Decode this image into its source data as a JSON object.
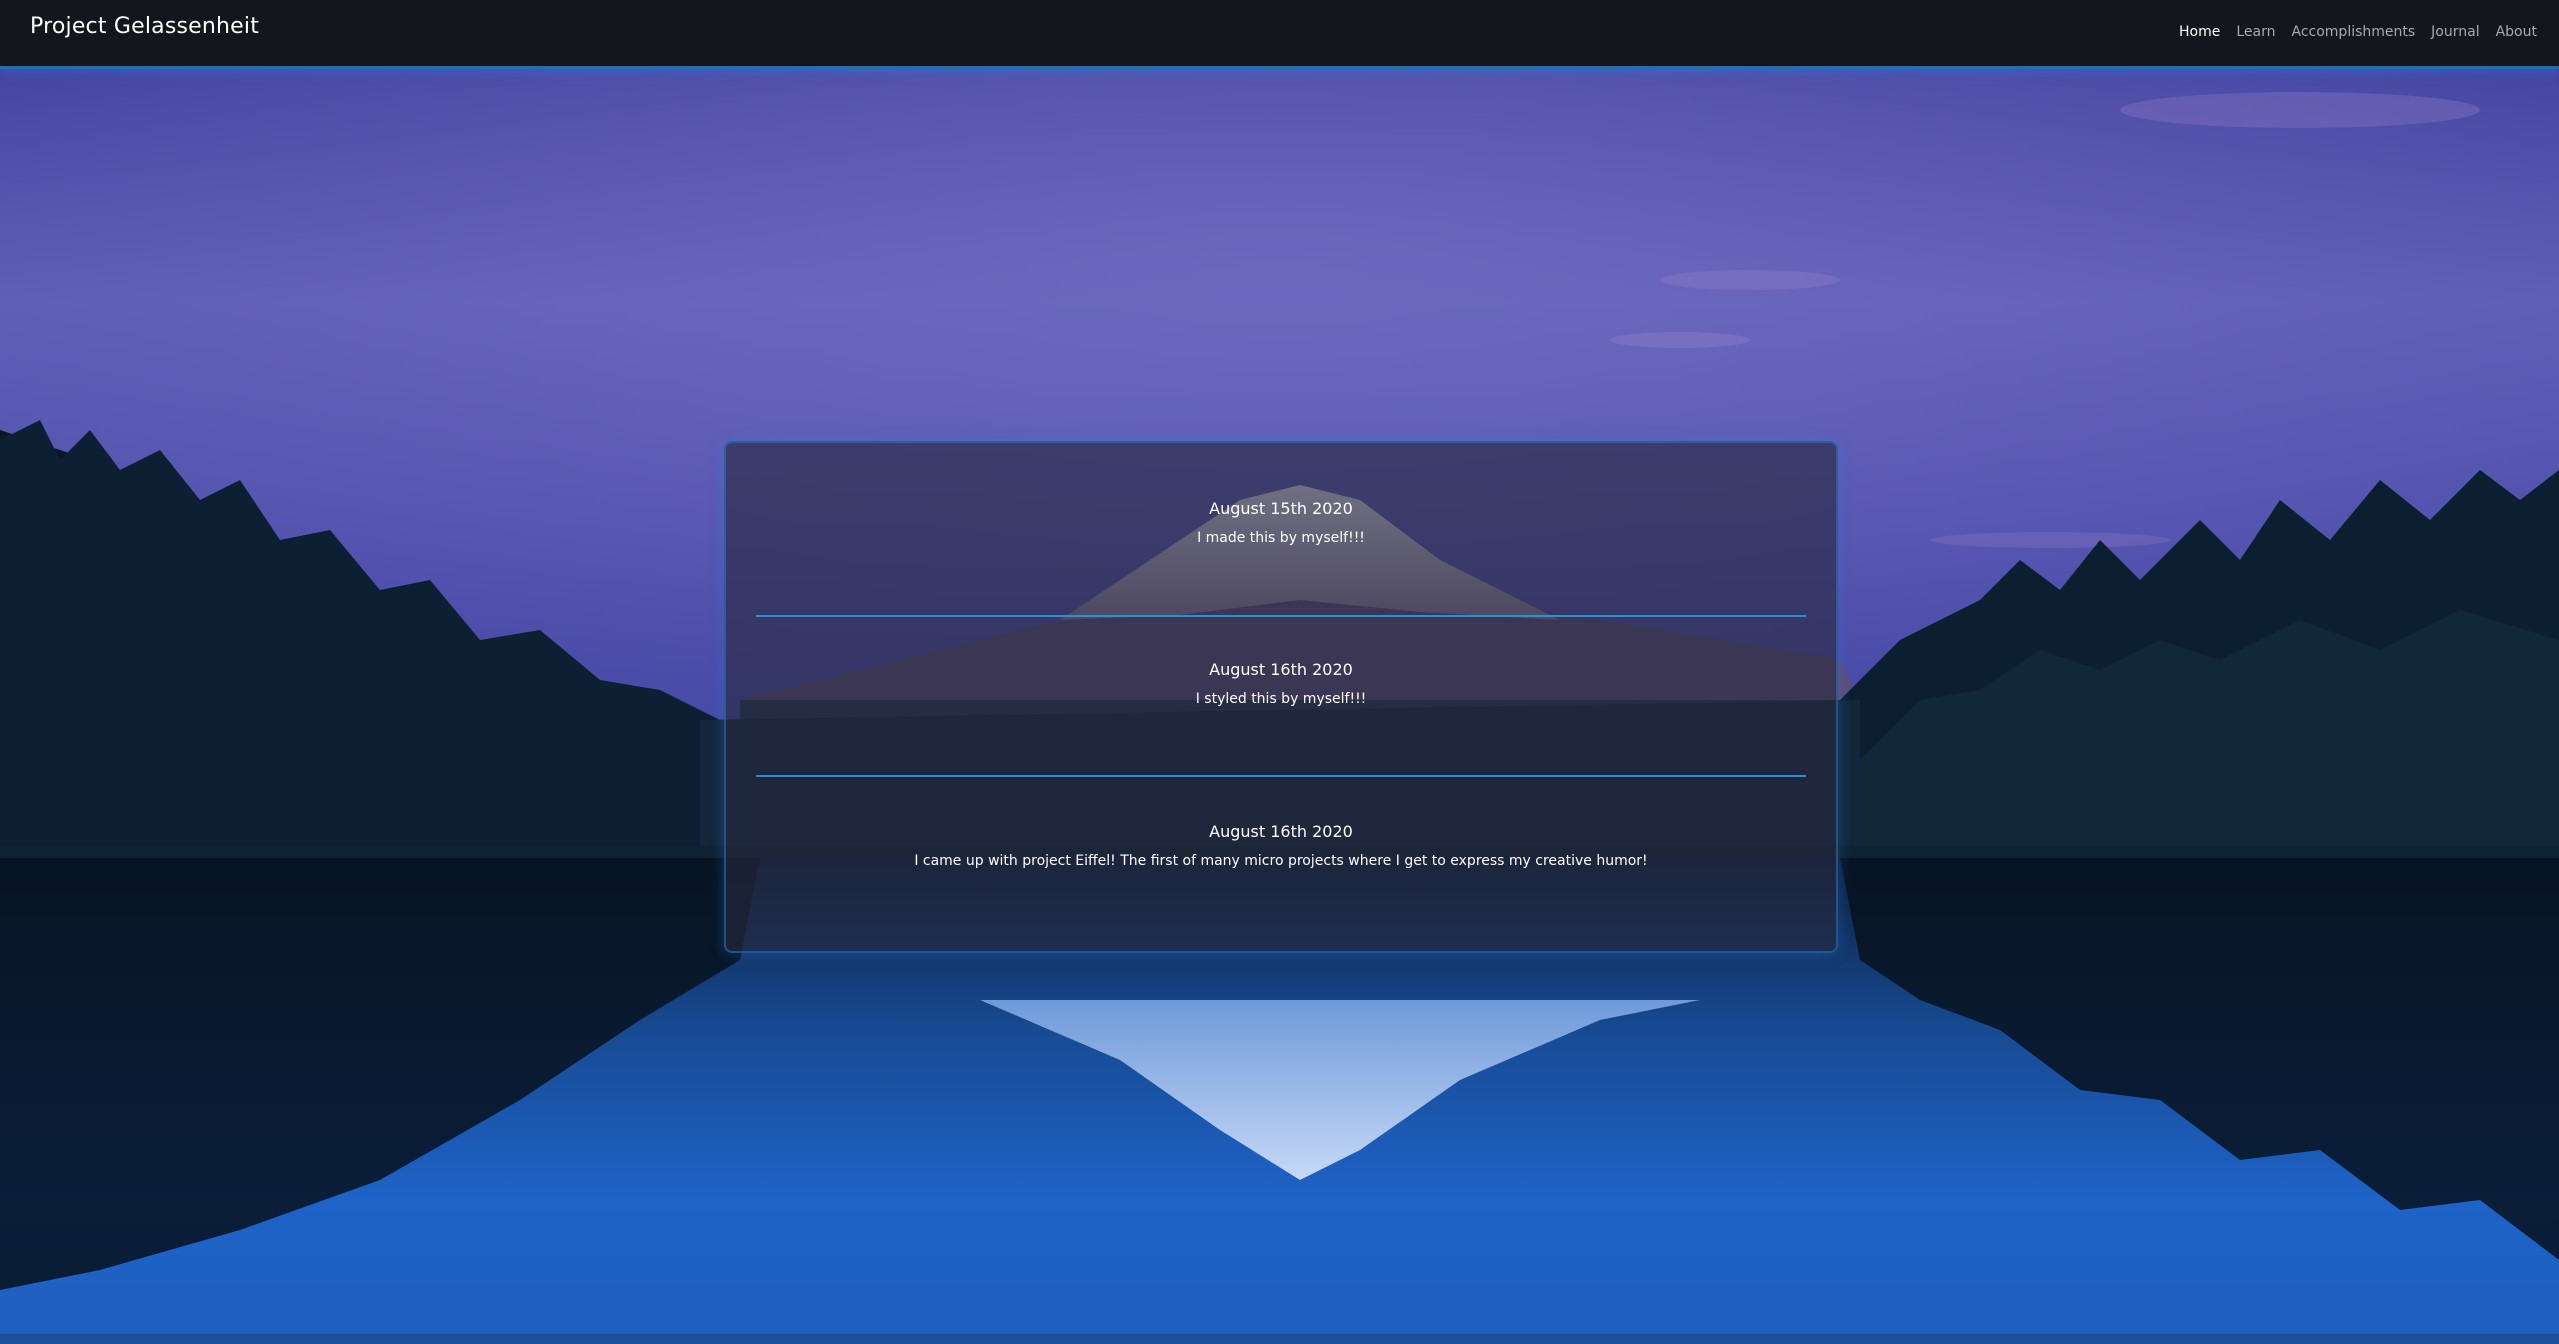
{
  "brand": "Project Gelassenheit",
  "nav": {
    "items": [
      {
        "label": "Home",
        "active": true
      },
      {
        "label": "Learn",
        "active": false
      },
      {
        "label": "Accomplishments",
        "active": false
      },
      {
        "label": "Journal",
        "active": false
      },
      {
        "label": "About",
        "active": false
      }
    ]
  },
  "journal": {
    "entries": [
      {
        "date": "August 15th 2020",
        "text": "I made this by myself!!!"
      },
      {
        "date": "August 16th 2020",
        "text": "I styled this by myself!!!"
      },
      {
        "date": "August 16th 2020",
        "text": "I came up with project Eiffel! The first of many micro projects where I get to express my creative humor!"
      }
    ]
  },
  "colors": {
    "navbar_bg": "#15161d",
    "accent": "#2a8fd8",
    "sky_top": "#3b3f9e",
    "sky_mid": "#5f5fb8",
    "lake": "#1a5fc4"
  }
}
